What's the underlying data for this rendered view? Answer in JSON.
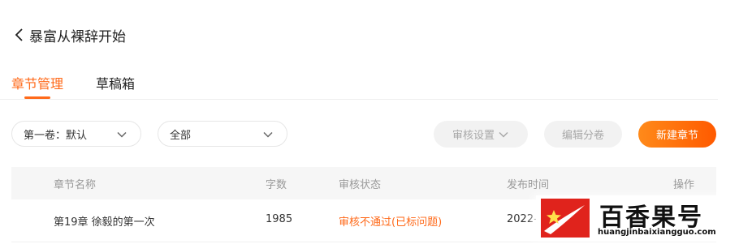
{
  "header": {
    "book_title": "暴富从裸辞开始"
  },
  "tabs": [
    {
      "label": "章节管理",
      "active": true
    },
    {
      "label": "草稿箱",
      "active": false
    }
  ],
  "toolbar": {
    "volume_select": "第一卷：默认",
    "filter_select": "全部",
    "review_settings": "审核设置",
    "edit_volumes": "编辑分卷",
    "new_chapter": "新建章节"
  },
  "table": {
    "columns": [
      "章节名称",
      "字数",
      "审核状态",
      "发布时间",
      "操作"
    ],
    "rows": [
      {
        "name": "第19章 徐毅的第一次",
        "words": "1985",
        "status": "审核不通过(已标问题)",
        "publish_time": "2022-"
      }
    ]
  },
  "watermark": {
    "name": "百香果号",
    "url": "huangjinbaixiangguo.com"
  },
  "colors": {
    "accent": "#ff6a1a",
    "primary_gradient_start": "#ff8a1a",
    "primary_gradient_end": "#ff5a00",
    "watermark_red": "#e0231c"
  }
}
